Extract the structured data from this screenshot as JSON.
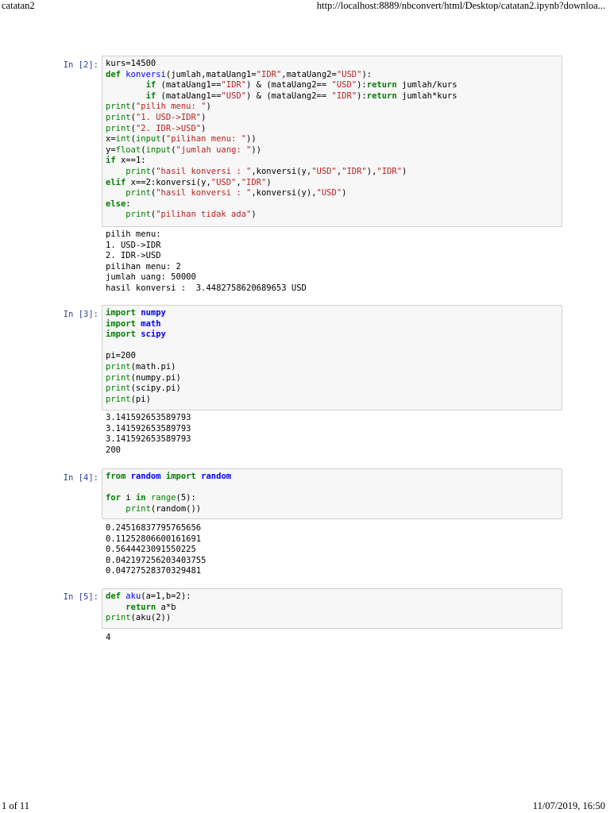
{
  "header": {
    "title": "catatan2",
    "url": "http://localhost:8889/nbconvert/html/Desktop/catatan2.ipynb?downloa..."
  },
  "footer": {
    "page": "1 of 11",
    "datetime": "11/07/2019, 16:50"
  },
  "cells": [
    {
      "prompt": "In [2]:",
      "code_lines": [
        "kurs=14500",
        "def konversi(jumlah,mataUang1=\"IDR\",mataUang2=\"USD\"):",
        "        if (mataUang1==\"IDR\") & (mataUang2== \"USD\"):return jumlah/kurs",
        "        if (mataUang1==\"USD\") & (mataUang2== \"IDR\"):return jumlah*kurs",
        "print(\"pilih menu: \")",
        "print(\"1. USD->IDR\")",
        "print(\"2. IDR->USD\")",
        "x=int(input(\"pilihan menu: \"))",
        "y=float(input(\"jumlah uang: \"))",
        "if x==1:",
        "    print(\"hasil konversi : \",konversi(y,\"USD\",\"IDR\"),\"IDR\")",
        "elif x==2:konversi(y,\"USD\",\"IDR\")",
        "    print(\"hasil konversi : \",konversi(y),\"USD\")",
        "else:",
        "    print(\"pilihan tidak ada\")"
      ],
      "output_lines": [
        "pilih menu:",
        "1. USD->IDR",
        "2. IDR->USD",
        "pilihan menu: 2",
        "jumlah uang: 50000",
        "hasil konversi :  3.4482758620689653 USD"
      ]
    },
    {
      "prompt": "In [3]:",
      "code_lines": [
        "import numpy",
        "import math",
        "import scipy",
        "",
        "pi=200",
        "print(math.pi)",
        "print(numpy.pi)",
        "print(scipy.pi)",
        "print(pi)"
      ],
      "output_lines": [
        "3.141592653589793",
        "3.141592653589793",
        "3.141592653589793",
        "200"
      ]
    },
    {
      "prompt": "In [4]:",
      "code_lines": [
        "from random import random",
        "",
        "for i in range(5):",
        "    print(random())"
      ],
      "output_lines": [
        "0.24516837795765656",
        "0.11252806600161691",
        "0.5644423091550225",
        "0.042197256203403755",
        "0.04727528370329481"
      ]
    },
    {
      "prompt": "In [5]:",
      "code_lines": [
        "def aku(a=1,b=2):",
        "    return a*b",
        "print(aku(2))"
      ],
      "output_lines": [
        "4"
      ]
    }
  ]
}
